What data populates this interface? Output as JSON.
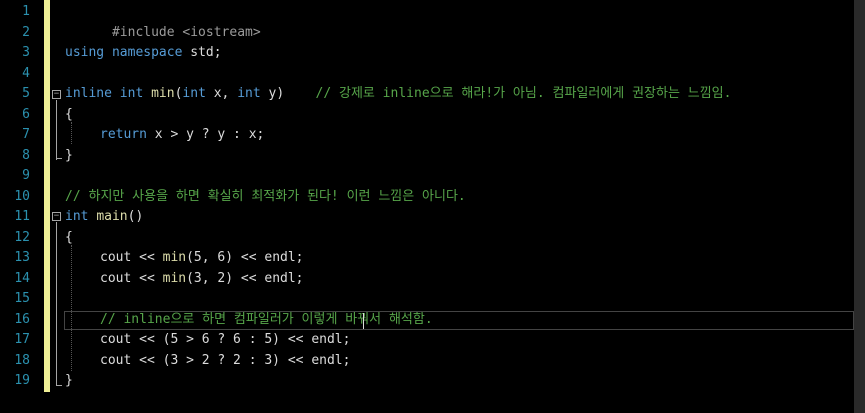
{
  "editor": {
    "line_numbers": [
      "1",
      "2",
      "3",
      "4",
      "5",
      "6",
      "7",
      "8",
      "9",
      "10",
      "11",
      "12",
      "13",
      "14",
      "15",
      "16",
      "17",
      "18",
      "19"
    ],
    "lines": {
      "l1": "#include <iostream>",
      "l3_kw1": "using",
      "l3_kw2": "namespace",
      "l3_rest": " std;",
      "l5_kw1": "inline",
      "l5_kw2": "int",
      "l5_fn": "min",
      "l5_p1": "(",
      "l5_kw3": "int",
      "l5_p2": " x, ",
      "l5_kw4": "int",
      "l5_p3": " y)    ",
      "l5_comment": "// 강제로 inline으로 해라!가 아님. 컴파일러에게 권장하는 느낌임.",
      "l6": "{",
      "l7_kw": "return",
      "l7_rest": " x > y ? y : x;",
      "l8": "}",
      "l10_comment": "// 하지만 사용을 하면 확실히 최적화가 된다! 이런 느낌은 아니다.",
      "l11_kw": "int",
      "l11_fn": "main",
      "l11_rest": "()",
      "l12": "{",
      "l13_a": "cout << ",
      "l13_fn": "min",
      "l13_b": "(5, 6) << endl;",
      "l14_a": "cout << ",
      "l14_fn": "min",
      "l14_b": "(3, 2) << endl;",
      "l16_comment": "// inline으로 하면 컴파일러가 이렇게 바꿔서 해석함.",
      "l17": "cout << (5 > 6 ? 6 : 5) << endl;",
      "l18": "cout << (3 > 2 ? 2 : 3) << endl;",
      "l19": "}"
    },
    "fold_glyph": "−",
    "colors": {
      "background": "#000000",
      "line_number": "#2b91af",
      "keyword": "#569cd6",
      "comment": "#57a64a",
      "function": "#dcdcaa",
      "text": "#dcdcdc",
      "change_bar": "#efef96"
    }
  }
}
